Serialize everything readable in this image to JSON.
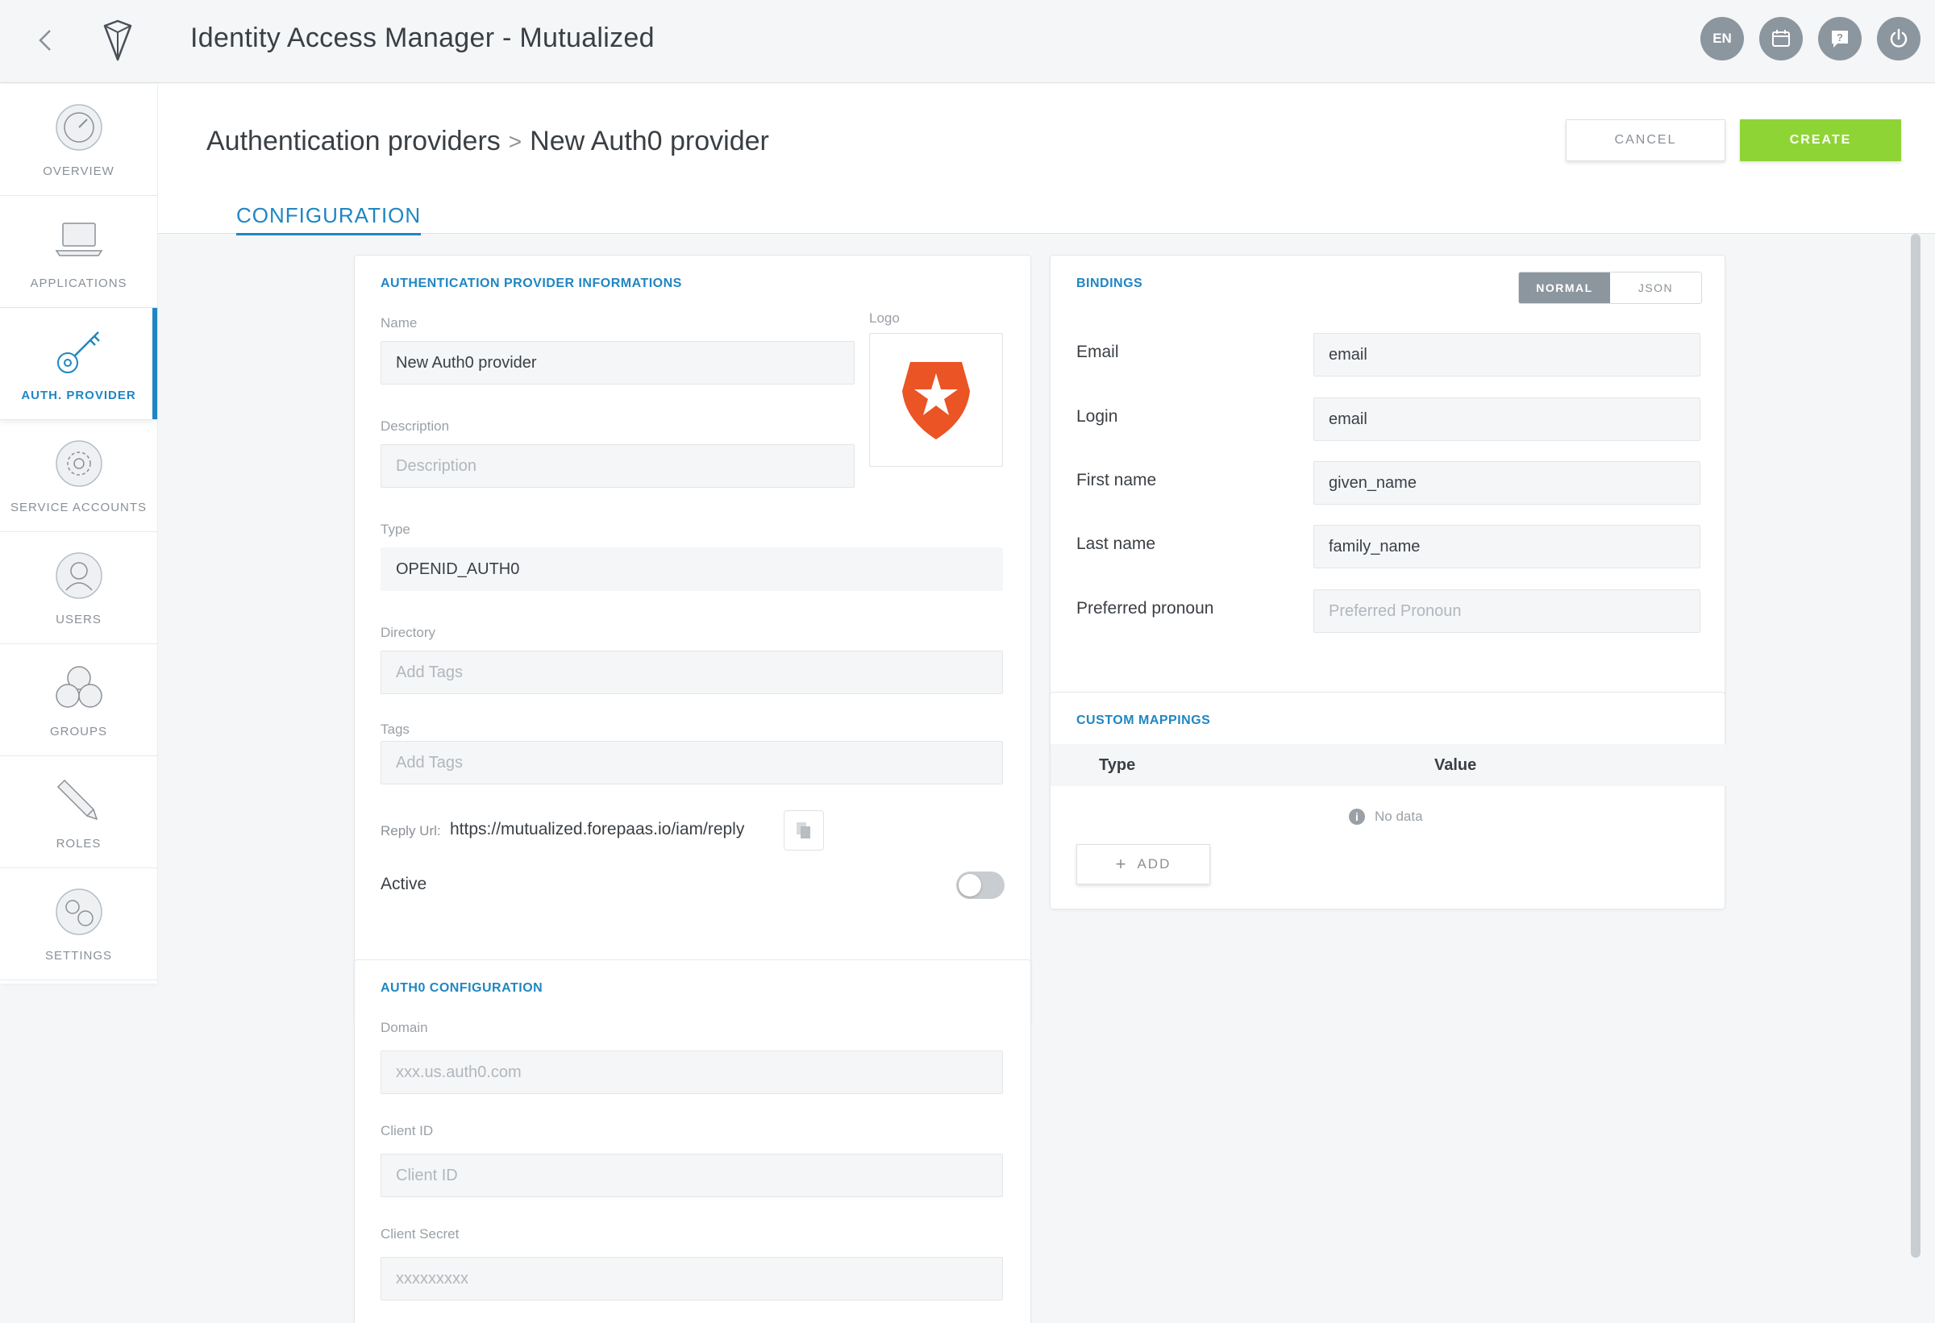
{
  "app": {
    "title": "Identity Access Manager - Mutualized"
  },
  "topbar": {
    "language": "EN"
  },
  "sidebar": {
    "items": [
      {
        "label": "OVERVIEW"
      },
      {
        "label": "APPLICATIONS"
      },
      {
        "label": "AUTH. PROVIDER"
      },
      {
        "label": "SERVICE ACCOUNTS"
      },
      {
        "label": "USERS"
      },
      {
        "label": "GROUPS"
      },
      {
        "label": "ROLES"
      },
      {
        "label": "SETTINGS"
      }
    ]
  },
  "header": {
    "breadcrumb_parent": "Authentication providers",
    "breadcrumb_sep": ">",
    "breadcrumb_current": "New Auth0 provider",
    "cancel_label": "CANCEL",
    "create_label": "CREATE",
    "tab_label": "CONFIGURATION"
  },
  "provider_info": {
    "title": "AUTHENTICATION PROVIDER INFORMATIONS",
    "name_label": "Name",
    "name_value": "New Auth0 provider",
    "logo_label": "Logo",
    "description_label": "Description",
    "description_placeholder": "Description",
    "type_label": "Type",
    "type_value": "OPENID_AUTH0",
    "directory_label": "Directory",
    "directory_placeholder": "Add Tags",
    "tags_label": "Tags",
    "tags_placeholder": "Add Tags",
    "reply_url_label": "Reply Url:",
    "reply_url_value": "https://mutualized.forepaas.io/iam/reply",
    "active_label": "Active"
  },
  "auth0_config": {
    "title": "AUTH0 CONFIGURATION",
    "domain_label": "Domain",
    "domain_placeholder": "xxx.us.auth0.com",
    "client_id_label": "Client ID",
    "client_id_placeholder": "Client ID",
    "client_secret_label": "Client Secret",
    "client_secret_placeholder": "xxxxxxxxx"
  },
  "bindings": {
    "title": "BINDINGS",
    "mode_normal": "NORMAL",
    "mode_json": "JSON",
    "rows": [
      {
        "label": "Email",
        "value": "email"
      },
      {
        "label": "Login",
        "value": "email"
      },
      {
        "label": "First name",
        "value": "given_name"
      },
      {
        "label": "Last name",
        "value": "family_name"
      },
      {
        "label": "Preferred pronoun",
        "placeholder": "Preferred Pronoun"
      }
    ]
  },
  "custom_mappings": {
    "title": "CUSTOM MAPPINGS",
    "col_type": "Type",
    "col_value": "Value",
    "empty_text": "No data",
    "add_label": "ADD"
  },
  "colors": {
    "accent": "#1f86c2",
    "create_green": "#8fd435",
    "auth0_orange": "#eb5424"
  }
}
